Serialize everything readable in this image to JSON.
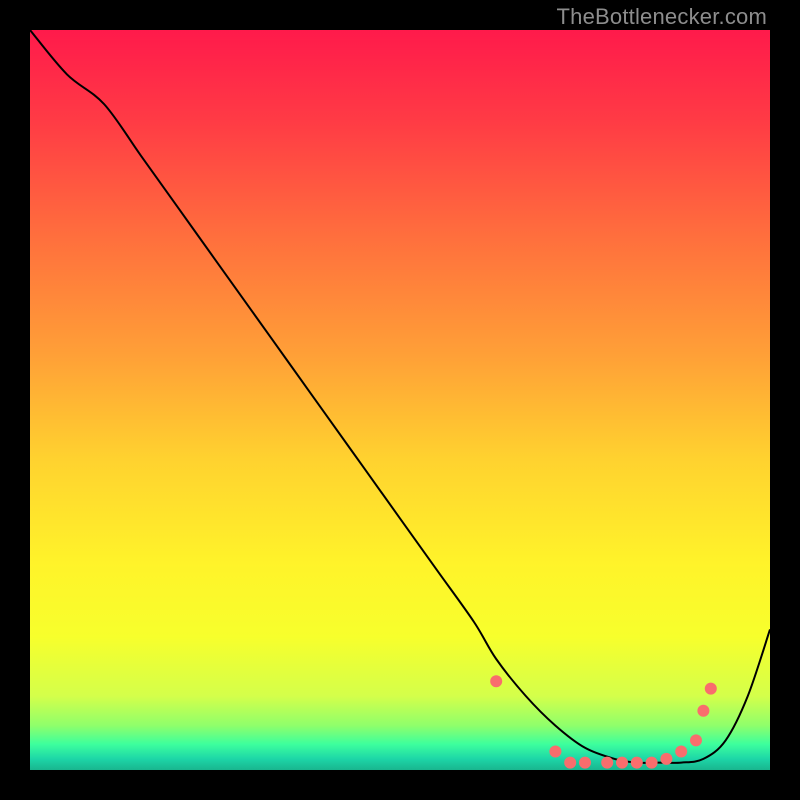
{
  "watermark": "TheBottlenecker.com",
  "chart_data": {
    "type": "line",
    "title": "",
    "xlabel": "",
    "ylabel": "",
    "xlim": [
      0,
      100
    ],
    "ylim": [
      0,
      100
    ],
    "grid": false,
    "legend": false,
    "background_gradient": [
      {
        "offset": 0.0,
        "color": "#ff1a4b"
      },
      {
        "offset": 0.12,
        "color": "#ff3a45"
      },
      {
        "offset": 0.28,
        "color": "#ff6f3d"
      },
      {
        "offset": 0.44,
        "color": "#ffa037"
      },
      {
        "offset": 0.58,
        "color": "#ffd22f"
      },
      {
        "offset": 0.72,
        "color": "#fff32a"
      },
      {
        "offset": 0.82,
        "color": "#f7ff2c"
      },
      {
        "offset": 0.9,
        "color": "#d4ff4a"
      },
      {
        "offset": 0.94,
        "color": "#8fff6b"
      },
      {
        "offset": 0.965,
        "color": "#3dff9d"
      },
      {
        "offset": 0.985,
        "color": "#1dd6a7"
      },
      {
        "offset": 1.0,
        "color": "#19b58e"
      }
    ],
    "series": [
      {
        "name": "curve",
        "color": "#000000",
        "width": 2,
        "x": [
          0,
          5,
          10,
          15,
          20,
          25,
          30,
          35,
          40,
          45,
          50,
          55,
          60,
          63,
          67,
          71,
          75,
          79,
          82,
          85,
          88,
          91,
          94,
          97,
          100
        ],
        "y": [
          100,
          94,
          90,
          83,
          76,
          69,
          62,
          55,
          48,
          41,
          34,
          27,
          20,
          15,
          10,
          6,
          3,
          1.5,
          1,
          1,
          1,
          1.5,
          4,
          10,
          19
        ]
      }
    ],
    "marker_series": [
      {
        "name": "dots",
        "color": "#f96d6d",
        "radius": 6,
        "x": [
          63,
          71,
          73,
          75,
          78,
          80,
          82,
          84,
          86,
          88,
          90,
          91,
          92
        ],
        "y": [
          12,
          2.5,
          1,
          1,
          1,
          1,
          1,
          1,
          1.5,
          2.5,
          4,
          8,
          11
        ]
      }
    ]
  }
}
